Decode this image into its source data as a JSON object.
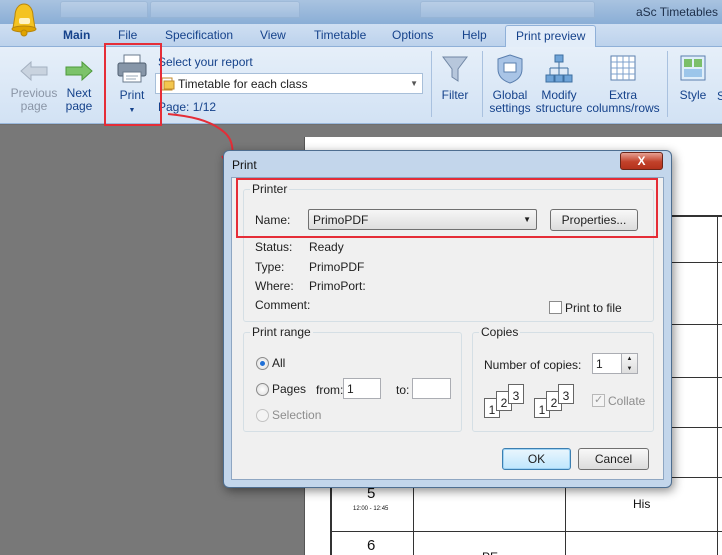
{
  "window": {
    "title": "aSc Timetables"
  },
  "ribbon_tabs": [
    {
      "label": "Main",
      "bold": true
    },
    {
      "label": "File"
    },
    {
      "label": "Specification"
    },
    {
      "label": "View"
    },
    {
      "label": "Timetable"
    },
    {
      "label": "Options"
    },
    {
      "label": "Help"
    },
    {
      "label": "Print preview",
      "selected": true
    }
  ],
  "ribbon": {
    "previous_page": {
      "line1": "Previous",
      "line2": "page"
    },
    "next_page": {
      "line1": "Next",
      "line2": "page"
    },
    "print": {
      "label": "Print"
    },
    "report_label": "Select your report",
    "report_value": "Timetable for each class",
    "page_info": "Page: 1/12",
    "filter": "Filter",
    "global_settings": {
      "line1": "Global",
      "line2": "settings"
    },
    "modify_structure": {
      "line1": "Modify",
      "line2": "structure"
    },
    "extra_columns": {
      "line1": "Extra",
      "line2": "columns/rows"
    },
    "style": "Style",
    "cut_off_label": "S"
  },
  "preview": {
    "periods": [
      {
        "number": "5",
        "time": "12:00 - 12:45"
      },
      {
        "number": "6"
      }
    ],
    "cells": {
      "his": "His",
      "pe": "PE"
    }
  },
  "dialog": {
    "title": "Print",
    "close_label": "X",
    "printer": {
      "legend": "Printer",
      "name_label": "Name:",
      "name_value": "PrimoPDF",
      "properties_button": "Properties...",
      "status_label": "Status:",
      "status_value": "Ready",
      "type_label": "Type:",
      "type_value": "PrimoPDF",
      "where_label": "Where:",
      "where_value": "PrimoPort:",
      "comment_label": "Comment:",
      "print_to_file": "Print to file"
    },
    "print_range": {
      "legend": "Print range",
      "all": "All",
      "pages": "Pages",
      "from_label": "from:",
      "from_value": "1",
      "to_label": "to:",
      "to_value": "",
      "selection": "Selection"
    },
    "copies": {
      "legend": "Copies",
      "number_label": "Number of copies:",
      "number_value": "1",
      "collate": "Collate",
      "page_digits": [
        "1",
        "2",
        "3"
      ]
    },
    "ok_button": "OK",
    "cancel_button": "Cancel"
  },
  "colors": {
    "accent": "#15428b",
    "annotation_red": "#e52d37",
    "dialog_frame": "#c3d6eb"
  }
}
